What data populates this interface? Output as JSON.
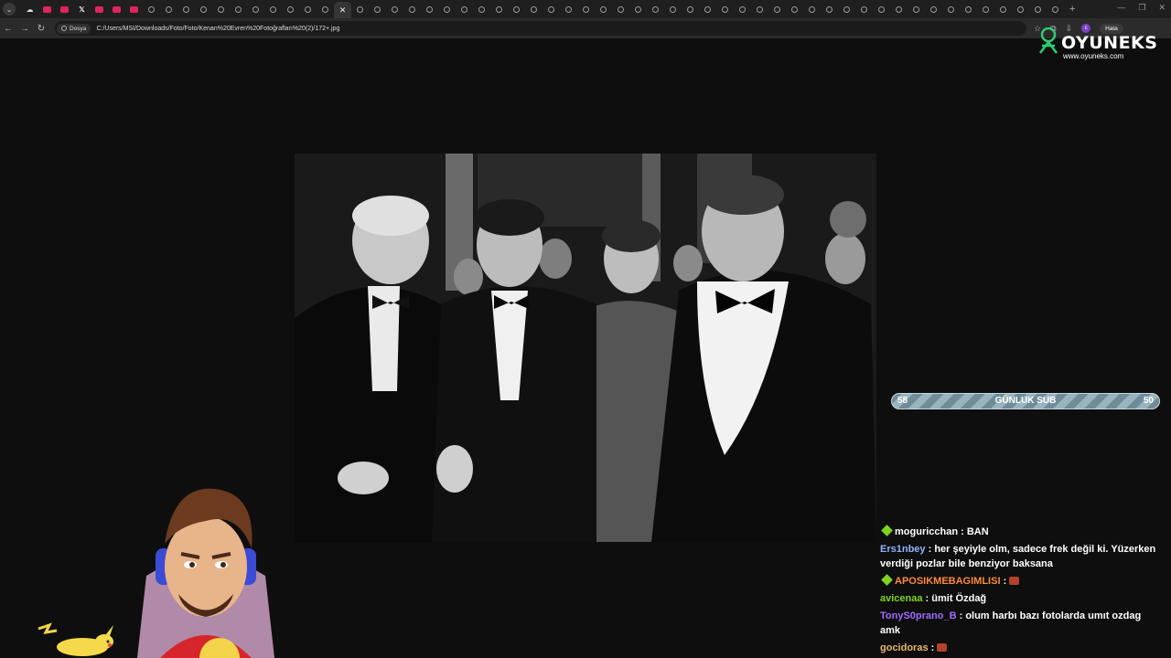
{
  "browser": {
    "tabs": [
      {
        "icon": "cloud-icon"
      },
      {
        "icon": "youtube-icon"
      },
      {
        "icon": "youtube-icon"
      },
      {
        "icon": "x-icon"
      },
      {
        "icon": "youtube-icon"
      },
      {
        "icon": "youtube-icon"
      },
      {
        "icon": "youtube-icon"
      },
      {
        "icon": "web-icon"
      },
      {
        "icon": "web-icon"
      },
      {
        "icon": "web-icon"
      },
      {
        "icon": "web-icon"
      },
      {
        "icon": "web-icon"
      },
      {
        "icon": "web-icon"
      },
      {
        "icon": "web-icon"
      },
      {
        "icon": "web-icon"
      },
      {
        "icon": "web-icon"
      },
      {
        "icon": "web-icon"
      },
      {
        "icon": "web-icon"
      },
      {
        "icon": "close-icon",
        "active": true
      },
      {
        "icon": "web-icon"
      },
      {
        "icon": "web-icon"
      },
      {
        "icon": "web-icon"
      },
      {
        "icon": "web-icon"
      },
      {
        "icon": "web-icon"
      },
      {
        "icon": "web-icon"
      },
      {
        "icon": "web-icon"
      },
      {
        "icon": "web-icon"
      },
      {
        "icon": "web-icon"
      },
      {
        "icon": "web-icon"
      },
      {
        "icon": "web-icon"
      },
      {
        "icon": "web-icon"
      },
      {
        "icon": "web-icon"
      },
      {
        "icon": "web-icon"
      },
      {
        "icon": "web-icon"
      },
      {
        "icon": "web-icon"
      },
      {
        "icon": "web-icon"
      },
      {
        "icon": "web-icon"
      },
      {
        "icon": "web-icon"
      },
      {
        "icon": "web-icon"
      },
      {
        "icon": "web-icon"
      },
      {
        "icon": "web-icon"
      },
      {
        "icon": "web-icon"
      },
      {
        "icon": "web-icon"
      },
      {
        "icon": "web-icon"
      },
      {
        "icon": "web-icon"
      },
      {
        "icon": "web-icon"
      },
      {
        "icon": "web-icon"
      },
      {
        "icon": "web-icon"
      },
      {
        "icon": "web-icon"
      },
      {
        "icon": "web-icon"
      },
      {
        "icon": "web-icon"
      },
      {
        "icon": "web-icon"
      },
      {
        "icon": "web-icon"
      },
      {
        "icon": "web-icon"
      },
      {
        "icon": "web-icon"
      },
      {
        "icon": "web-icon"
      },
      {
        "icon": "web-icon"
      },
      {
        "icon": "web-icon"
      },
      {
        "icon": "web-icon"
      },
      {
        "icon": "web-icon"
      }
    ],
    "chip_label": "Dosya",
    "url": "C:/Users/MSI/Downloads/Foto/Foto/Kenan%20Evren%20Fotoğrafları%20(2)/172+.jpg",
    "profile_initial": "c",
    "update_label": "Hata"
  },
  "overlay": {
    "logo_text": "OYUNEKS",
    "logo_url": "www.oyuneks.com",
    "sub_goal": {
      "current": "58",
      "title": "GÜNLUK SUB",
      "target": "50"
    }
  },
  "chat": [
    {
      "badge": true,
      "user": "moguricchan",
      "color": "#ffffff",
      "text": "BAN"
    },
    {
      "badge": false,
      "user": "Ers1nbey",
      "color": "#8fb4ff",
      "text": "her şeyiyle olm, sadece frek değil ki. Yüzerken verdiği pozlar bile benziyor baksana"
    },
    {
      "badge": true,
      "user": "APOSIKMEBAGIMLISI",
      "color": "#ff8a3d",
      "text": "",
      "emote": true
    },
    {
      "badge": false,
      "user": "avicenaa",
      "color": "#7ed321",
      "text": "ümit Özdağ"
    },
    {
      "badge": false,
      "user": "TonyS0prano_B",
      "color": "#a06bff",
      "text": "olum harbı bazı fotolarda umıt ozdag amk"
    },
    {
      "badge": false,
      "user": "gocidoras",
      "color": "#e8b86d",
      "text": "",
      "emote": true
    }
  ]
}
